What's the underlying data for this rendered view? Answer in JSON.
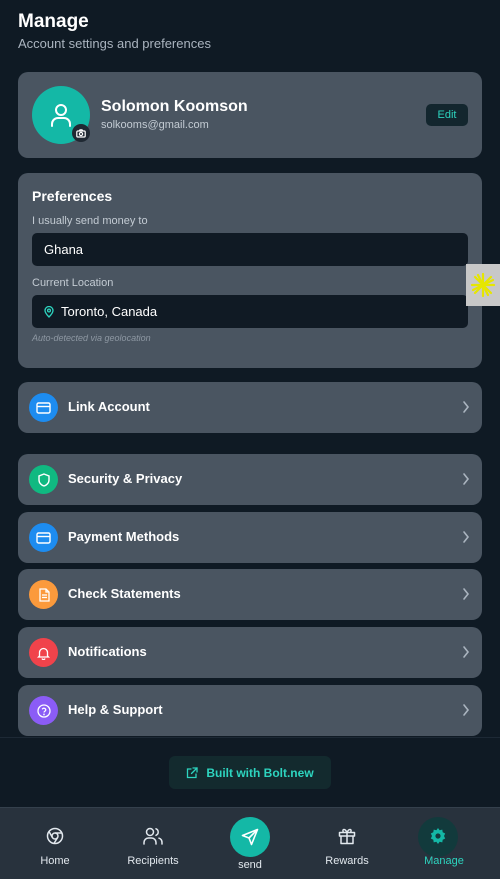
{
  "header": {
    "title": "Manage",
    "subtitle": "Account settings and preferences"
  },
  "profile": {
    "name": "Solomon Koomson",
    "email": "solkooms@gmail.com",
    "edit_label": "Edit"
  },
  "preferences": {
    "title": "Preferences",
    "send_to_label": "I usually send money to",
    "send_to_value": "Ghana",
    "location_label": "Current Location",
    "location_value": "Toronto, Canada",
    "location_hint": "Auto-detected via geolocation"
  },
  "menu": {
    "link_account": {
      "label": "Link Account",
      "icon": "card-icon",
      "color": "#1d8cf0"
    },
    "items": [
      {
        "label": "Security & Privacy",
        "icon": "shield-icon",
        "color": "#10b981"
      },
      {
        "label": "Payment Methods",
        "icon": "card-icon",
        "color": "#1d8cf0"
      },
      {
        "label": "Check Statements",
        "icon": "document-icon",
        "color": "#fb9a3c"
      },
      {
        "label": "Notifications",
        "icon": "bell-icon",
        "color": "#f0434b"
      },
      {
        "label": "Help & Support",
        "icon": "help-icon",
        "color": "#8b5cf6"
      }
    ]
  },
  "footer": {
    "bolt_label": "Built with Bolt.new"
  },
  "tabbar": {
    "tabs": [
      {
        "label": "Home",
        "icon": "chrome-icon"
      },
      {
        "label": "Recipients",
        "icon": "users-icon"
      },
      {
        "label": "send",
        "icon": "send-icon"
      },
      {
        "label": "Rewards",
        "icon": "gift-icon"
      },
      {
        "label": "Manage",
        "icon": "gear-icon",
        "active": true
      }
    ]
  },
  "colors": {
    "accent": "#14b8a6",
    "background": "#0f1a24",
    "card": "#4a5561"
  }
}
